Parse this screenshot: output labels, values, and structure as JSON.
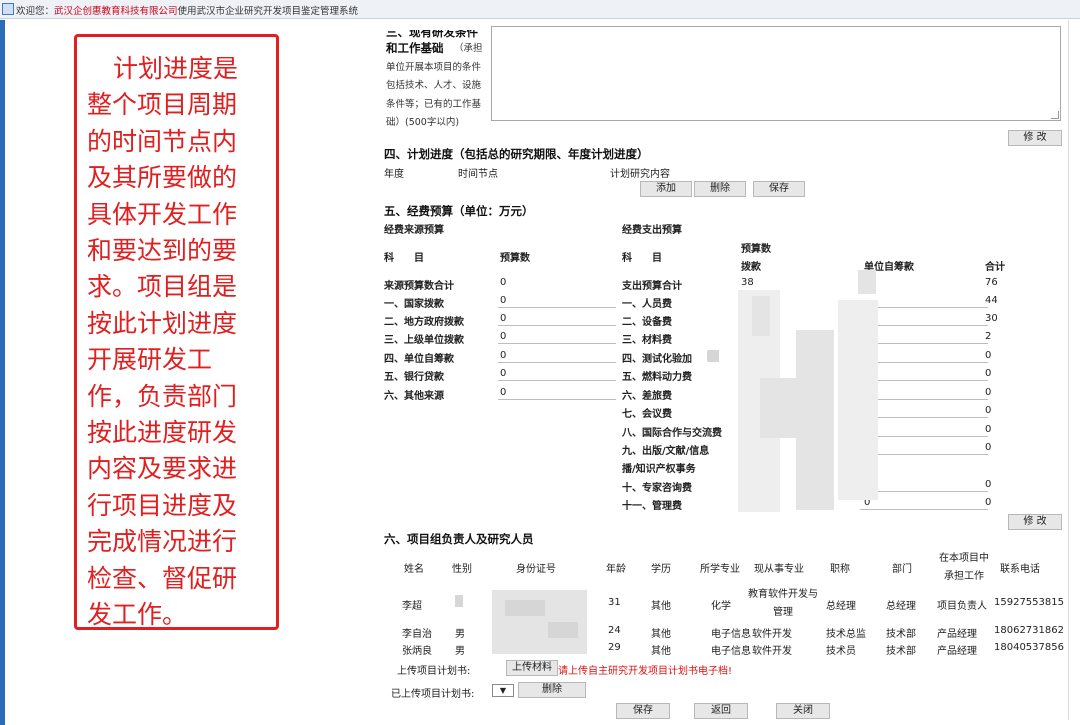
{
  "topbar": {
    "prefix": "欢迎您：",
    "company": "武汉企创惠教育科技有限公司",
    "suffix": "使用武汉市企业研究开发项目鉴定管理系统"
  },
  "annotation": {
    "text": "计划进度是整个项目周期的时间节点内及其所要做的具体开发工作和要达到的要求。项目组是按此计划进度开展研发工作，负责部门按此进度研发内容及要求进行项目进度及完成情况进行检查、督促研发工作。"
  },
  "section3": {
    "title_line1": "三、现有研发条件",
    "title_line2": "和工作基础",
    "note": "（承担单位开展本项目的条件包括技术、人才、设施条件等；已有的工作基础）(500字以内)",
    "modify_label": "修 改"
  },
  "section4": {
    "title": "四、计划进度（包括总的研究期限、年度计划进度）",
    "col_year": "年度",
    "col_time": "时间节点",
    "col_content": "计划研究内容",
    "add_label": "添加",
    "delete_label": "删除",
    "save_label": "保存"
  },
  "section5": {
    "title": "五、经费预算（单位：万元）",
    "source_title": "经费来源预算",
    "expense_title": "经费支出预算",
    "head_subject": "科　　目",
    "head_budget": "预算数",
    "head_budget2": "预算数",
    "head_grant": "拨款",
    "head_self": "单位自筹款",
    "head_total": "合计",
    "sources": [
      {
        "label": "来源预算数合计",
        "value": "0"
      },
      {
        "label": "一、国家拨款",
        "value": "0"
      },
      {
        "label": "二、地方政府拨款",
        "value": "0"
      },
      {
        "label": "三、上级单位拨款",
        "value": "0"
      },
      {
        "label": "四、单位自筹款",
        "value": "0"
      },
      {
        "label": "五、银行贷款",
        "value": "0"
      },
      {
        "label": "六、其他来源",
        "value": "0"
      }
    ],
    "expenses": [
      {
        "label": "支出预算合计",
        "grant": "38",
        "self": "",
        "total": "76"
      },
      {
        "label": "一、人员费",
        "grant": "",
        "self": "",
        "total": "44"
      },
      {
        "label": "二、设备费",
        "grant": "",
        "self": "",
        "total": "30"
      },
      {
        "label": "三、材料费",
        "grant": "",
        "self": "",
        "total": "2"
      },
      {
        "label": "四、测试化验加",
        "grant": "",
        "self": "",
        "total": "0"
      },
      {
        "label": "五、燃料动力费",
        "grant": "",
        "self": "",
        "total": "0"
      },
      {
        "label": "六、差旅费",
        "grant": "",
        "self": "",
        "total": "0"
      },
      {
        "label": "七、会议费",
        "grant": "",
        "self": "",
        "total": "0"
      },
      {
        "label": "八、国际合作与交流费",
        "grant": "",
        "self": "",
        "total": "0"
      },
      {
        "label": "九、出版/文献/信息",
        "grant": "",
        "self": "",
        "total": "0"
      },
      {
        "label": "播/知识产权事务",
        "grant": "",
        "self": "",
        "total": ""
      },
      {
        "label": "十、专家咨询费",
        "grant": "",
        "self": "",
        "total": "0"
      },
      {
        "label": "十一、管理费",
        "grant": "",
        "self": "0",
        "total": "0"
      }
    ],
    "modify_label": "修 改"
  },
  "section6": {
    "title": "六、项目组负责人及研究人员",
    "headers": [
      "姓名",
      "性别",
      "身份证号",
      "年龄",
      "学历",
      "所学专业",
      "现从事专业",
      "职称",
      "部门",
      "在本项目中承担工作",
      "联系电话"
    ],
    "members": [
      {
        "name": "李超",
        "gender": "",
        "id": "",
        "age": "31",
        "edu": "其他",
        "major": "化学",
        "work": "教育软件开发与管理",
        "title": "总经理",
        "dept": "总经理",
        "role": "项目负责人",
        "phone": "15927553815"
      },
      {
        "name": "李自治",
        "gender": "男",
        "id": "",
        "age": "24",
        "edu": "其他",
        "major": "电子信息",
        "work": "软件开发",
        "title": "技术总监",
        "dept": "技术部",
        "role": "产品经理",
        "phone": "18062731862"
      },
      {
        "name": "张炳良",
        "gender": "男",
        "id": "50",
        "age": "29",
        "edu": "其他",
        "major": "电子信息",
        "work": "软件开发",
        "title": "技术员",
        "dept": "技术部",
        "role": "产品经理",
        "phone": "18040537856"
      }
    ],
    "upload_label": "上传项目计划书:",
    "upload_button": "上传材料",
    "upload_hint": "请上传自主研究开发项目计划书电子档!",
    "uploaded_label": "已上传项目计划书:",
    "select_value": "▼",
    "delete_label": "删除",
    "save_label": "保存",
    "back_label": "返回",
    "close_label": "关闭"
  }
}
